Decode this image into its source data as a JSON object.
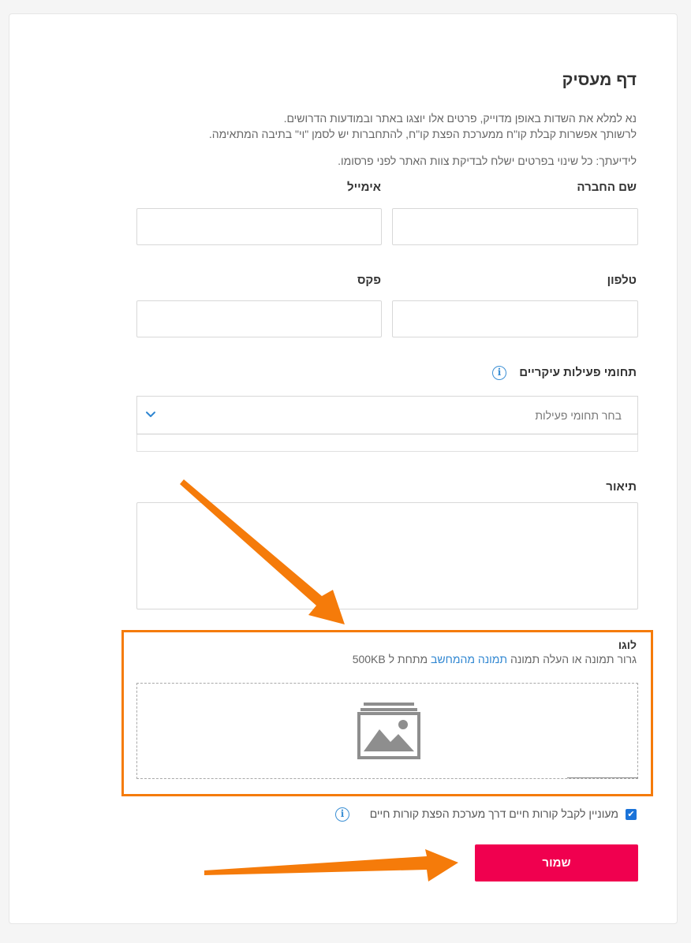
{
  "page": {
    "title": "דף מעסיק",
    "intro_line1": "נא למלא את השדות באופן מדוייק, פרטים אלו יוצגו באתר ובמודעות הדרושים.",
    "intro_line2": "לרשותך אפשרות קבלת קו\"ח ממערכת הפצת קו\"ח, להתחברות יש לסמן \"וי\" בתיבה המתאימה.",
    "note": "לידיעתך: כל שינוי בפרטים ישלח לבדיקת צוות האתר לפני פרסומו."
  },
  "form": {
    "company_name_label": "שם החברה",
    "email_label": "אימייל",
    "phone_label": "טלפון",
    "fax_label": "פקס",
    "activity_label": "תחומי פעילות עיקריים",
    "activity_placeholder": "בחר תחומי פעילות",
    "description_label": "תיאור",
    "logo_label": "לוגו",
    "logo_hint_prefix": "גרור תמונה או העלה תמונה ",
    "logo_hint_link": "תמונה מהמחשב",
    "logo_hint_suffix": " מתחת ל 500KB",
    "consent_label": "מעוניין לקבל קורות חיים דרך מערכת הפצת קורות חיים",
    "consent_checked": true,
    "save_label": "שמור"
  },
  "icons": {
    "info": "info-icon",
    "chevron": "chevron-down-icon",
    "image_placeholder": "image-placeholder-icon",
    "check": "checkmark-icon"
  },
  "colors": {
    "accent_blue": "#2f86d1",
    "save_button": "#f0004f",
    "annotation_orange": "#f57b0a"
  }
}
